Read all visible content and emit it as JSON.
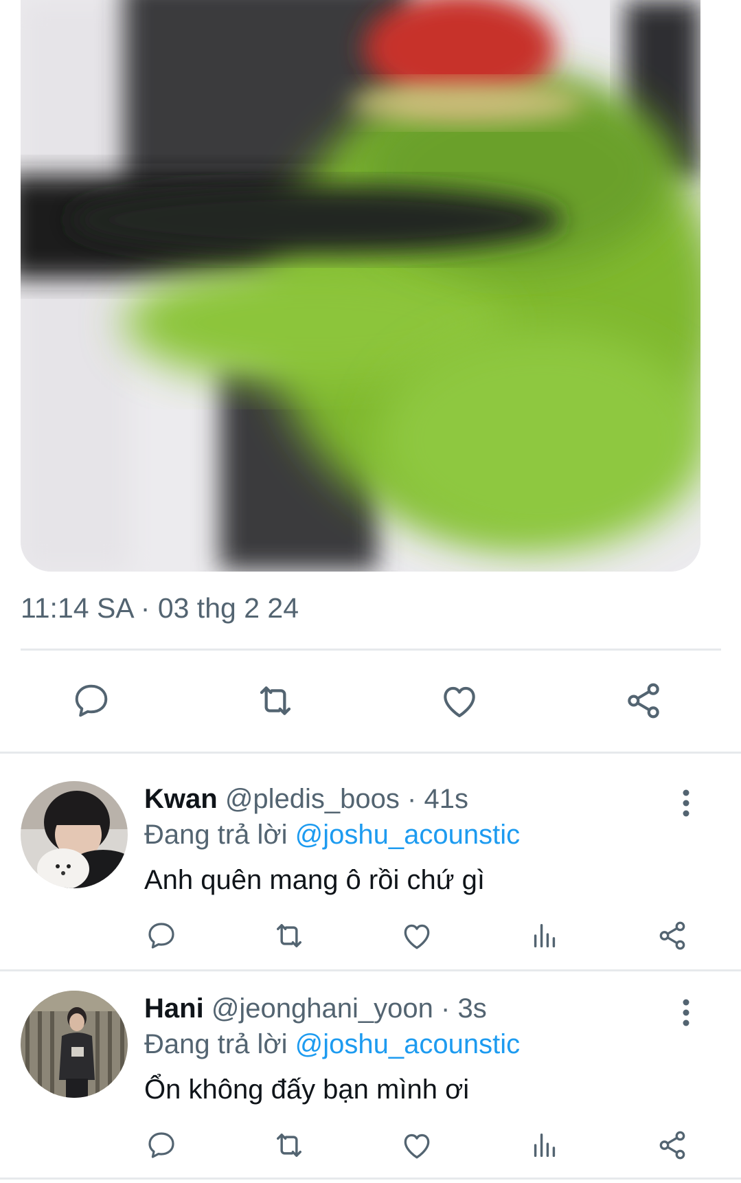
{
  "tweet": {
    "timestamp": "11:14 SA · 03 thg 2 24",
    "actions": [
      "reply-icon",
      "retweet-icon",
      "like-icon",
      "share-icon"
    ]
  },
  "replies": [
    {
      "name": "Kwan",
      "handle": "@pledis_boos",
      "dot": "·",
      "time": "41s",
      "replying_prefix": "Đang trả lời",
      "replying_to": "@joshu_acounstic",
      "text": "Anh quên mang ô rồi chứ gì"
    },
    {
      "name": "Hani",
      "handle": "@jeonghani_yoon",
      "dot": "·",
      "time": "3s",
      "replying_prefix": "Đang trả lời",
      "replying_to": "@joshu_acounstic",
      "text": "Ổn không đấy bạn mình ơi"
    }
  ],
  "colors": {
    "text": "#0f1419",
    "secondary": "#536471",
    "accent": "#1d9bf0",
    "divider": "#e6e9ec"
  }
}
